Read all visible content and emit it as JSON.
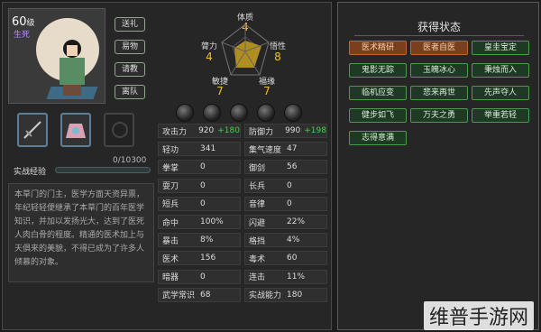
{
  "character": {
    "level": "60",
    "level_unit": "级",
    "role": "生死"
  },
  "side_buttons": [
    "送礼",
    "易物",
    "请教",
    "离队"
  ],
  "experience": {
    "label": "实战经验",
    "value": "0/10300",
    "progress": 0
  },
  "description": "本草门的门主，医学方面天资异禀，年纪轻轻便继承了本草门的百年医学知识，并加以发扬光大，达到了医死人肉白骨的程度。精通的医术加上与天俱来的美貌，不得已成为了许多人倾慕的对象。",
  "radar": {
    "top": {
      "label": "体质",
      "value": "4"
    },
    "left": {
      "label": "膂力",
      "value": "4"
    },
    "right": {
      "label": "悟性",
      "value": "8"
    },
    "bottom_left": {
      "label": "敏捷",
      "value": "7"
    },
    "bottom_right": {
      "label": "福缘",
      "value": "7"
    }
  },
  "stats": [
    [
      {
        "k": "攻击力",
        "v": "920",
        "g": "+180"
      },
      {
        "k": "防御力",
        "v": "990",
        "g": "+198"
      }
    ],
    [
      {
        "k": "轻功",
        "v": "341",
        "g": ""
      },
      {
        "k": "集气速度",
        "v": "47",
        "g": ""
      }
    ],
    [
      {
        "k": "拳掌",
        "v": "0",
        "g": ""
      },
      {
        "k": "御剑",
        "v": "56",
        "g": ""
      }
    ],
    [
      {
        "k": "耍刀",
        "v": "0",
        "g": ""
      },
      {
        "k": "长兵",
        "v": "0",
        "g": ""
      }
    ],
    [
      {
        "k": "短兵",
        "v": "0",
        "g": ""
      },
      {
        "k": "音律",
        "v": "0",
        "g": ""
      }
    ],
    [
      {
        "k": "命中",
        "v": "100%",
        "g": ""
      },
      {
        "k": "闪避",
        "v": "22%",
        "g": ""
      }
    ],
    [
      {
        "k": "暴击",
        "v": "8%",
        "g": ""
      },
      {
        "k": "格挡",
        "v": "4%",
        "g": ""
      }
    ],
    [
      {
        "k": "医术",
        "v": "156",
        "g": ""
      },
      {
        "k": "毒术",
        "v": "60",
        "g": ""
      }
    ],
    [
      {
        "k": "暗器",
        "v": "0",
        "g": ""
      },
      {
        "k": "连击",
        "v": "11%",
        "g": ""
      }
    ],
    [
      {
        "k": "武学常识",
        "v": "68",
        "g": ""
      },
      {
        "k": "实战能力",
        "v": "180",
        "g": ""
      }
    ]
  ],
  "status_panel": {
    "title": "获得状态",
    "tags": [
      {
        "label": "医术精研",
        "hi": true
      },
      {
        "label": "医者自医",
        "hi": true
      },
      {
        "label": "皇圭宝定",
        "hi": false
      },
      {
        "label": "鬼影无踪",
        "hi": false
      },
      {
        "label": "玉魄冰心",
        "hi": false
      },
      {
        "label": "秉烛而入",
        "hi": false
      },
      {
        "label": "临机应变",
        "hi": false
      },
      {
        "label": "悲来再世",
        "hi": false
      },
      {
        "label": "先声夺人",
        "hi": false
      },
      {
        "label": "健步如飞",
        "hi": false
      },
      {
        "label": "万夫之勇",
        "hi": false
      },
      {
        "label": "举重若轻",
        "hi": false
      },
      {
        "label": "志得意满",
        "hi": false
      }
    ]
  },
  "watermark": "维普手游网",
  "colors": {
    "gain": "#4ccf4c",
    "radar_value": "#f0c020",
    "tag_hi": "#7a3f1c",
    "tag": "#1f3a24"
  }
}
